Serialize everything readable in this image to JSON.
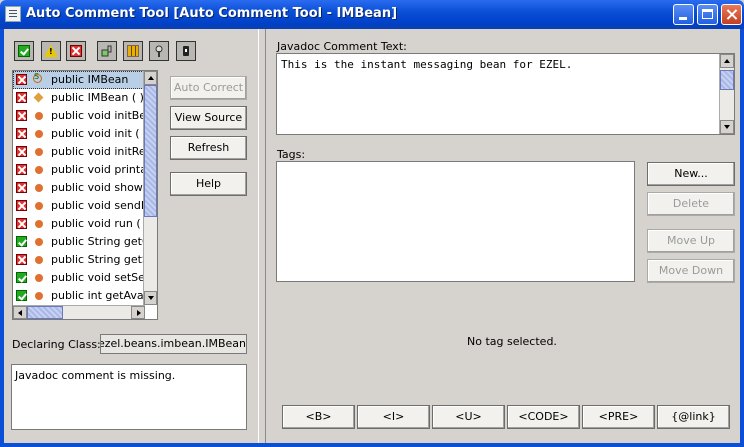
{
  "window": {
    "title": "Auto Comment Tool [Auto Comment Tool - IMBean]"
  },
  "toolbar": {
    "filters": [
      {
        "icon": "green-check-icon",
        "on": true
      },
      {
        "icon": "warning-icon",
        "on": true
      },
      {
        "icon": "red-x-icon",
        "on": true
      },
      {
        "icon": "key-icon",
        "on": true
      },
      {
        "icon": "grid-icon",
        "on": true
      },
      {
        "icon": "lock-key-icon",
        "on": true
      },
      {
        "icon": "padlock-icon",
        "on": true
      }
    ]
  },
  "members": [
    {
      "status": "error",
      "kind": "class",
      "label": "public IMBean",
      "selected": true
    },
    {
      "status": "error",
      "kind": "constructor",
      "label": "public IMBean (  )"
    },
    {
      "status": "error",
      "kind": "method",
      "label": "public void initBean"
    },
    {
      "status": "error",
      "kind": "method",
      "label": "public void init ( Str"
    },
    {
      "status": "error",
      "kind": "method",
      "label": "public void initRend"
    },
    {
      "status": "error",
      "kind": "method",
      "label": "public void printall ("
    },
    {
      "status": "error",
      "kind": "method",
      "label": "public void showPe"
    },
    {
      "status": "error",
      "kind": "method",
      "label": "public void sendMe"
    },
    {
      "status": "error",
      "kind": "method",
      "label": "public void run (  )"
    },
    {
      "status": "ok",
      "kind": "method",
      "label": "public String getCha"
    },
    {
      "status": "error",
      "kind": "method",
      "label": "public String getSer"
    },
    {
      "status": "ok",
      "kind": "method",
      "label": "public void setSend"
    },
    {
      "status": "ok",
      "kind": "method",
      "label": "public int getAvailal"
    }
  ],
  "actions": {
    "auto_correct": "Auto Correct",
    "view_source": "View Source",
    "refresh": "Refresh",
    "help": "Help"
  },
  "declaring_class": {
    "label": "Declaring Class:",
    "value": "cta.ezel.beans.imbean.IMBean"
  },
  "message": "Javadoc comment is missing.",
  "javadoc": {
    "label": "Javadoc Comment Text:",
    "text": "This is the instant messaging bean for EZEL."
  },
  "tags": {
    "label": "Tags:",
    "empty_text": "No tag selected.",
    "new": "New...",
    "delete": "Delete",
    "move_up": "Move Up",
    "move_down": "Move Down"
  },
  "format_buttons": [
    "<B>",
    "<I>",
    "<U>",
    "<CODE>",
    "<PRE>",
    "{@link}"
  ],
  "colors": {
    "titlebar": "#0a4fd6",
    "selection": "#b8cfe6",
    "error": "#dd3333",
    "ok": "#22aa22"
  }
}
